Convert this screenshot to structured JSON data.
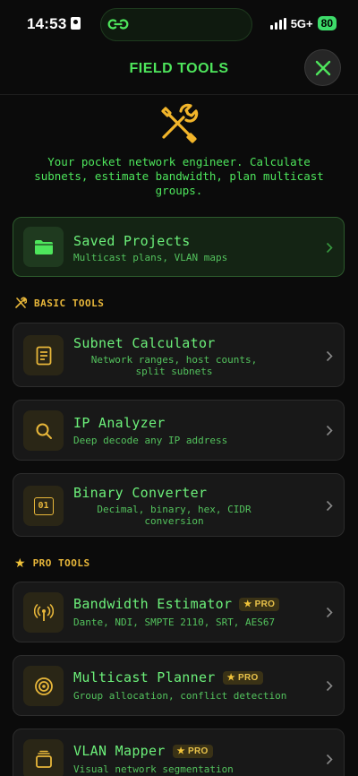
{
  "status_bar": {
    "time": "14:53",
    "network": "5G+",
    "battery": "80"
  },
  "header": {
    "title": "FIELD TOOLS"
  },
  "hero": {
    "tagline": "Your pocket network engineer. Calculate subnets, estimate bandwidth, plan multicast groups."
  },
  "saved": {
    "title": "Saved Projects",
    "desc": "Multicast plans, VLAN maps"
  },
  "sections": {
    "basic": "BASIC TOOLS",
    "pro": "PRO TOOLS"
  },
  "basic_tools": [
    {
      "title": "Subnet Calculator",
      "desc": "Network ranges, host counts, split subnets",
      "icon": "document-icon"
    },
    {
      "title": "IP Analyzer",
      "desc": "Deep decode any IP address",
      "icon": "magnifier-icon"
    },
    {
      "title": "Binary Converter",
      "desc": "Decimal, binary, hex, CIDR conversion",
      "icon": "binary-icon",
      "icon_text": "01"
    }
  ],
  "pro_tools": [
    {
      "title": "Bandwidth Estimator",
      "desc": "Dante, NDI, SMPTE 2110, SRT, AES67",
      "badge": "PRO",
      "icon": "antenna-icon"
    },
    {
      "title": "Multicast Planner",
      "desc": "Group allocation, conflict detection",
      "badge": "PRO",
      "icon": "target-icon"
    },
    {
      "title": "VLAN Mapper",
      "desc": "Visual network segmentation",
      "badge": "PRO",
      "icon": "layers-icon"
    }
  ],
  "colors": {
    "accent_green": "#4ee65c",
    "accent_gold": "#e8b73a",
    "background": "#0b0b0b",
    "card": "#181818"
  }
}
